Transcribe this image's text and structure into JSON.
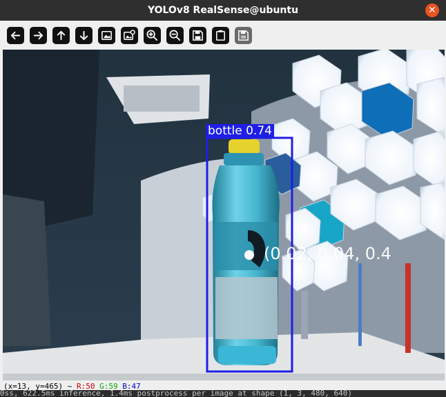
{
  "window": {
    "title": "YOLOv8 RealSense@ubuntu",
    "close_glyph": "✕"
  },
  "toolbar": {
    "buttons": [
      {
        "name": "pan-left-icon"
      },
      {
        "name": "pan-right-icon"
      },
      {
        "name": "pan-up-icon"
      },
      {
        "name": "pan-down-icon"
      },
      {
        "name": "zoom-fit-icon"
      },
      {
        "name": "zoom-original-icon"
      },
      {
        "name": "zoom-in-icon"
      },
      {
        "name": "zoom-out-icon"
      },
      {
        "name": "save-icon"
      },
      {
        "name": "properties-icon"
      },
      {
        "name": "overlay-icon"
      }
    ]
  },
  "detection": {
    "label": "bottle 0.74",
    "box_color": "#1e1ee6",
    "coordinates": "(0.02, 0.04, 0.4"
  },
  "status": {
    "coords": "(x=13, y=465) ~",
    "r": "R:50",
    "g": "G:59",
    "b": "B:47"
  },
  "terminal": {
    "line": "0ss, 622.5ms inference, 1.4ms postprocess per image at shape (1, 3, 480, 640)"
  },
  "colors": {
    "titlebar": "#2f2f2f",
    "close": "#e95420",
    "toolbar": "#efefef"
  }
}
